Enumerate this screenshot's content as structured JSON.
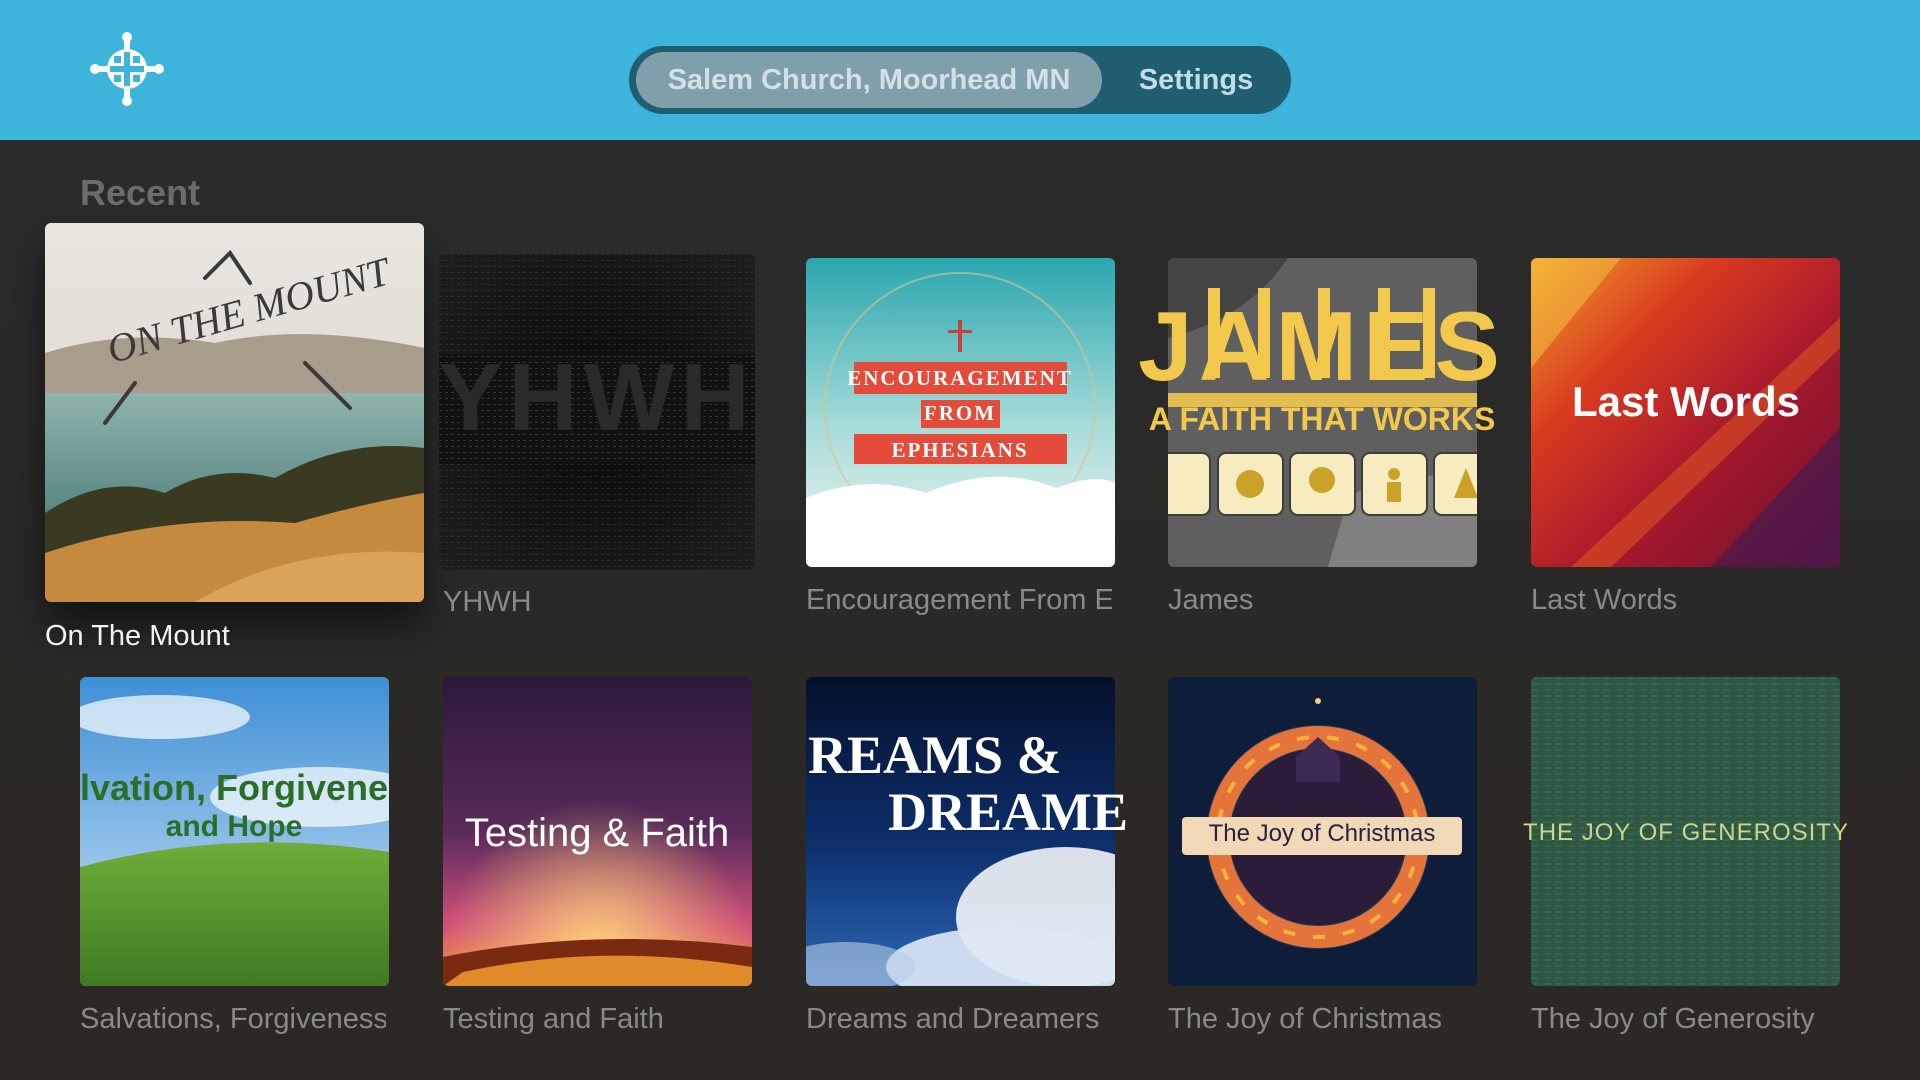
{
  "header": {
    "logo_icon": "church-cross-logo",
    "church_label": "Salem Church, Moorhead MN",
    "settings_label": "Settings",
    "bar_color": "#3db5db"
  },
  "section": {
    "title": "Recent"
  },
  "series": [
    {
      "title": "On The Mount",
      "art_text": "ON THE MOUNT",
      "focused": true
    },
    {
      "title": "YHWH",
      "art_text": "YHWH"
    },
    {
      "title": "Encouragement From Ephesians",
      "art_lines": [
        "ENCOURAGEMENT",
        "FROM",
        "EPHESIANS"
      ]
    },
    {
      "title": "James",
      "art_text": "JAMES",
      "art_subtitle": "A FAITH THAT WORKS"
    },
    {
      "title": "Last Words",
      "art_text": "Last Words"
    },
    {
      "title": "Salvations, Forgiveness and Hope",
      "art_text": "lvation, Forgivene",
      "art_subtitle": "and Hope"
    },
    {
      "title": "Testing and Faith",
      "art_text": "Testing & Faith"
    },
    {
      "title": "Dreams and Dreamers",
      "art_text": "REAMS &",
      "art_subtitle": "DREAME"
    },
    {
      "title": "The Joy of Christmas",
      "art_text": "The Joy of Christmas"
    },
    {
      "title": "The Joy of Generosity",
      "art_text": "THE JOY OF GENEROSITY"
    }
  ]
}
